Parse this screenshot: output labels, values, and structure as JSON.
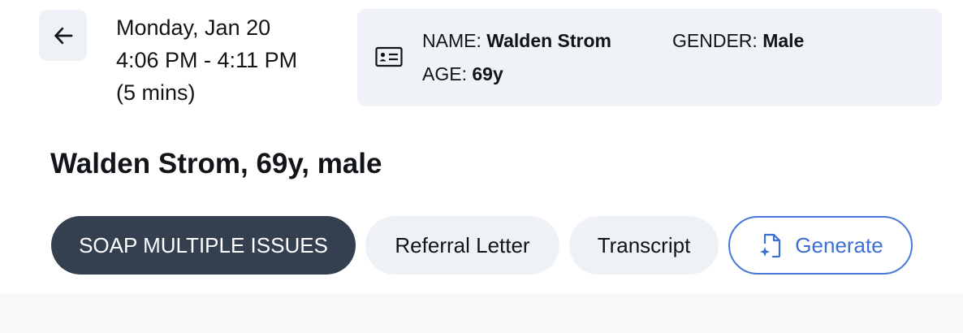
{
  "visit": {
    "date": "Monday, Jan 20",
    "time_range": "4:06 PM - 4:11 PM",
    "duration": "(5 mins)"
  },
  "patient_card": {
    "name_label": "NAME:",
    "name_value": "Walden Strom",
    "gender_label": "GENDER:",
    "gender_value": "Male",
    "age_label": "AGE:",
    "age_value": "69y"
  },
  "heading": "Walden Strom, 69y, male",
  "tabs": [
    {
      "label": "SOAP MULTIPLE ISSUES",
      "active": true
    },
    {
      "label": "Referral Letter",
      "active": false
    },
    {
      "label": "Transcript",
      "active": false
    }
  ],
  "generate_button": {
    "label": "Generate",
    "icon": "file-sparkle-icon"
  },
  "icons": {
    "back": "arrow-left-icon",
    "card": "id-card-icon"
  },
  "colors": {
    "active_tab_bg": "#343f4f",
    "inactive_tab_bg": "#eef2f7",
    "accent_blue": "#3b6fd6",
    "card_bg": "#eff2f7"
  }
}
